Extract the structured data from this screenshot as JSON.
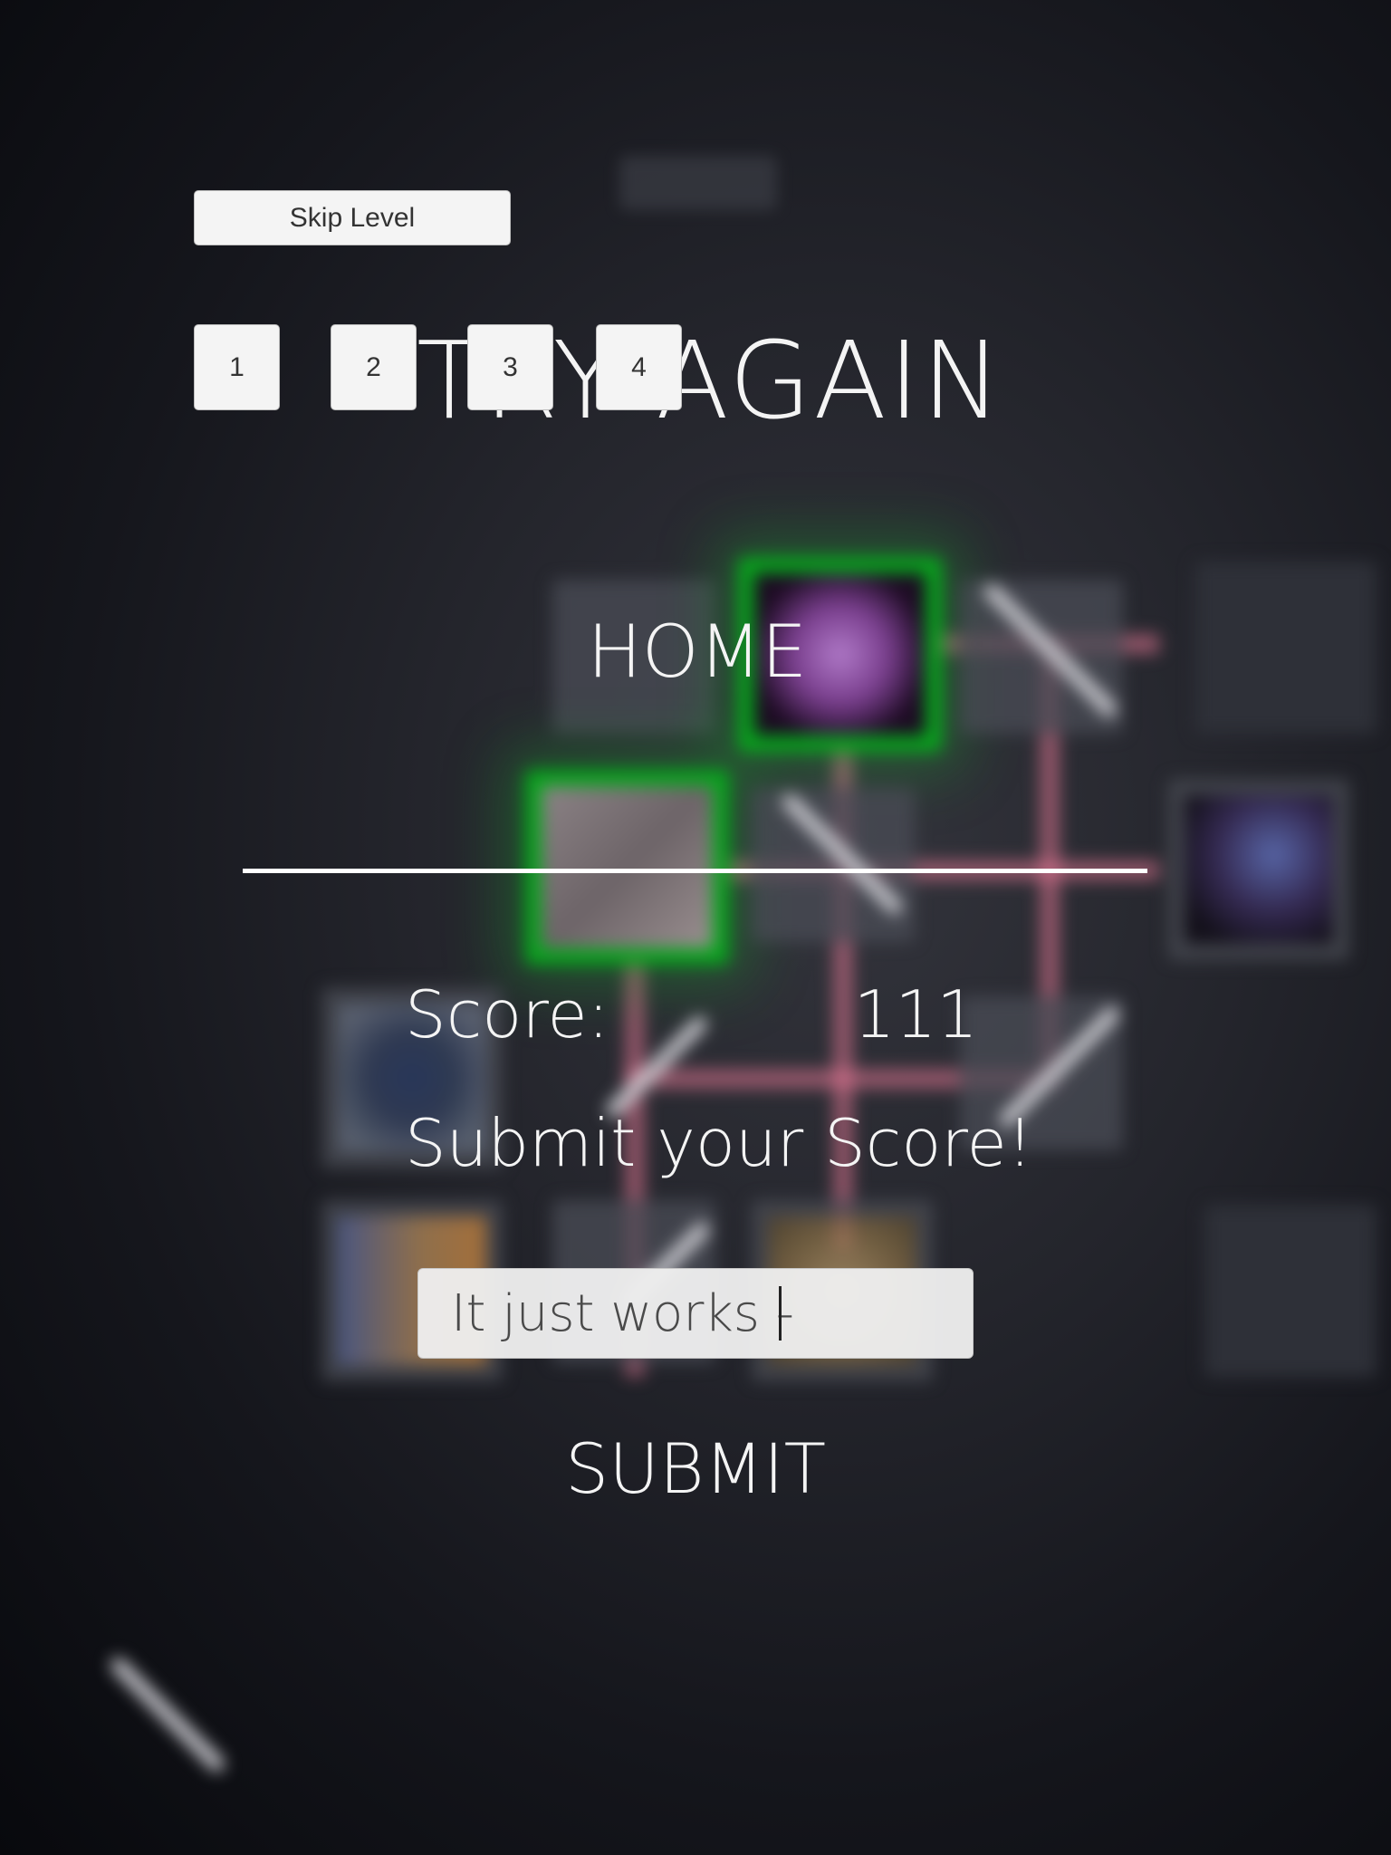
{
  "controls": {
    "skip_level": "Skip Level",
    "levels": [
      "1",
      "2",
      "3",
      "4"
    ]
  },
  "menu": {
    "try_again": "TRY AGAIN",
    "home": "HOME"
  },
  "score": {
    "label": "Score:",
    "value": "111"
  },
  "submit": {
    "prompt": "Submit your Score!",
    "input_value": "It just works - ",
    "button": "SUBMIT"
  },
  "colors": {
    "highlight_tile": "#08a51d",
    "laser_beam": "#e67896",
    "text": "#f4f4f4"
  }
}
